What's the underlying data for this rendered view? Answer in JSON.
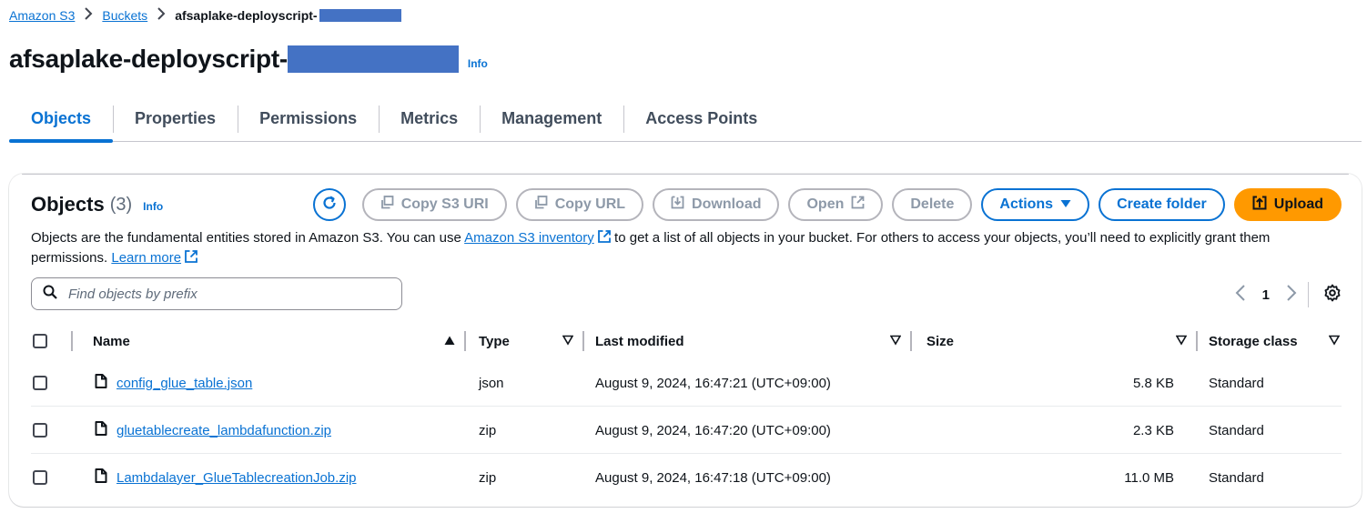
{
  "breadcrumb": {
    "items": [
      "Amazon S3",
      "Buckets"
    ],
    "current": "afsaplake-deployscript-"
  },
  "page": {
    "title": "afsaplake-deployscript-",
    "info": "Info"
  },
  "tabs": [
    {
      "label": "Objects",
      "active": true
    },
    {
      "label": "Properties",
      "active": false
    },
    {
      "label": "Permissions",
      "active": false
    },
    {
      "label": "Metrics",
      "active": false
    },
    {
      "label": "Management",
      "active": false
    },
    {
      "label": "Access Points",
      "active": false
    }
  ],
  "objects_panel": {
    "title": "Objects",
    "count": "(3)",
    "info": "Info",
    "buttons": {
      "copy_s3_uri": "Copy S3 URI",
      "copy_url": "Copy URL",
      "download": "Download",
      "open": "Open",
      "delete": "Delete",
      "actions": "Actions",
      "create_folder": "Create folder",
      "upload": "Upload"
    },
    "description": {
      "part1": "Objects are the fundamental entities stored in Amazon S3. You can use ",
      "inventory_link": "Amazon S3 inventory",
      "part2": " to get a list of all objects in your bucket. For others to access your objects, you’ll need to explicitly grant them permissions. ",
      "learn_more": "Learn more"
    },
    "search": {
      "placeholder": "Find objects by prefix",
      "value": ""
    },
    "pagination": {
      "current_page": "1"
    },
    "columns": {
      "name": "Name",
      "type": "Type",
      "last_modified": "Last modified",
      "size": "Size",
      "storage_class": "Storage class"
    },
    "rows": [
      {
        "name": "config_glue_table.json",
        "type": "json",
        "last_modified": "August 9, 2024, 16:47:21 (UTC+09:00)",
        "size": "5.8 KB",
        "storage_class": "Standard"
      },
      {
        "name": "gluetablecreate_lambdafunction.zip",
        "type": "zip",
        "last_modified": "August 9, 2024, 16:47:20 (UTC+09:00)",
        "size": "2.3 KB",
        "storage_class": "Standard"
      },
      {
        "name": "Lambdalayer_GlueTablecreationJob.zip",
        "type": "zip",
        "last_modified": "August 9, 2024, 16:47:18 (UTC+09:00)",
        "size": "11.0 MB",
        "storage_class": "Standard"
      }
    ]
  },
  "colors": {
    "link": "#0972d3",
    "upload_button": "#ff9900",
    "redaction": "#4472c4"
  },
  "icons": [
    "chevron-right-icon",
    "refresh-icon",
    "copy-icon",
    "download-icon",
    "external-link-icon",
    "caret-down-icon",
    "upload-icon",
    "search-icon",
    "chevron-left-icon",
    "gear-icon",
    "sort-ascending-icon",
    "sort-icon",
    "file-icon",
    "checkbox"
  ]
}
